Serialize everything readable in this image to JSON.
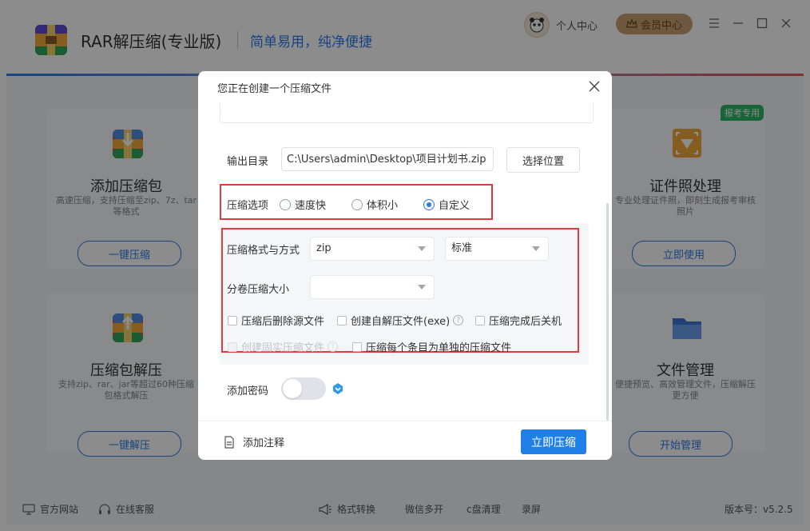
{
  "app": {
    "title": "RAR解压缩(专业版)",
    "slogan": "简单易用，纯净便捷",
    "user_center": "个人中心",
    "member_center": "会员中心",
    "accent_color": "#2f7ce8"
  },
  "cards": {
    "add_archive": {
      "title": "添加压缩包",
      "desc": "高速压缩，支持压缩至zip、7z、tar等格式",
      "button": "一键压缩"
    },
    "id_photo": {
      "badge": "报考专用",
      "title": "证件照处理",
      "desc": "专业处理证件照，即刻生成报考审核照片",
      "button": "立即使用"
    },
    "extract": {
      "title": "压缩包解压",
      "desc": "支持zip、rar、jar等超过60种压缩包格式解压",
      "button": "一键解压"
    },
    "file_mgmt": {
      "title": "文件管理",
      "desc": "便捷预览、高效管理文件，压缩解压更方便",
      "button": "开始管理"
    }
  },
  "bottom_bar": {
    "website": "官方网站",
    "support": "在线客服",
    "format_convert": "格式转换",
    "wechat_multi": "微信多开",
    "c_clean": "c盘清理",
    "record": "录屏",
    "version": "版本号：v5.2.5"
  },
  "dialog": {
    "title": "您正在创建一个压缩文件",
    "output_label": "输出目录",
    "output_path": "C:\\Users\\admin\\Desktop\\项目计划书.zip",
    "choose_button": "选择位置",
    "compress_option_label": "压缩选项",
    "options": [
      "速度快",
      "体积小",
      "自定义"
    ],
    "selected_option": "自定义",
    "format_label": "压缩格式与方式",
    "format_value": "zip",
    "method_value": "标准",
    "split_label": "分卷压缩大小",
    "split_value": "",
    "checkboxes": {
      "delete_source": "压缩后删除源文件",
      "self_extract": "创建自解压文件(exe)",
      "shutdown": "压缩完成后关机",
      "solid": "创建固实压缩文件",
      "each_separate": "压缩每个条目为单独的压缩文件"
    },
    "password_label": "添加密码",
    "password_enabled": false,
    "add_note": "添加注释",
    "primary_button": "立即压缩"
  }
}
